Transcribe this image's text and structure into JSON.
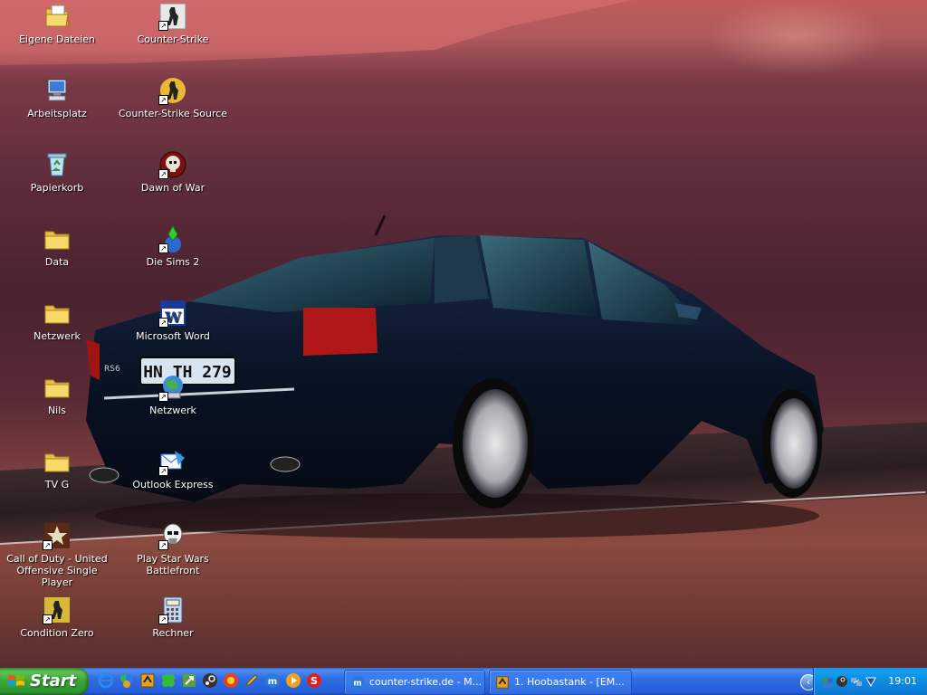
{
  "desktop": {
    "icons": [
      {
        "label": "Eigene Dateien",
        "icon": "my-documents-icon",
        "shortcut": false
      },
      {
        "label": "Arbeitsplatz",
        "icon": "my-computer-icon",
        "shortcut": false
      },
      {
        "label": "Papierkorb",
        "icon": "recycle-bin-icon",
        "shortcut": false
      },
      {
        "label": "Data",
        "icon": "folder-icon",
        "shortcut": false
      },
      {
        "label": "Netzwerk",
        "icon": "folder-icon",
        "shortcut": false
      },
      {
        "label": "Nils",
        "icon": "folder-icon",
        "shortcut": false
      },
      {
        "label": "TV G",
        "icon": "folder-icon",
        "shortcut": false
      },
      {
        "label": "Call of Duty - United Offensive Single Player",
        "icon": "call-of-duty-icon",
        "shortcut": true
      },
      {
        "label": "Condition Zero",
        "icon": "condition-zero-icon",
        "shortcut": true
      },
      {
        "label": "Counter-Strike",
        "icon": "counter-strike-icon",
        "shortcut": true
      },
      {
        "label": "Counter-Strike Source",
        "icon": "counter-strike-source-icon",
        "shortcut": true
      },
      {
        "label": "Dawn of War",
        "icon": "dawn-of-war-icon",
        "shortcut": true
      },
      {
        "label": "Die Sims 2",
        "icon": "sims-2-icon",
        "shortcut": true
      },
      {
        "label": "Microsoft Word",
        "icon": "word-icon",
        "shortcut": true
      },
      {
        "label": "Netzwerk",
        "icon": "network-icon",
        "shortcut": true
      },
      {
        "label": "Outlook Express",
        "icon": "outlook-express-icon",
        "shortcut": true
      },
      {
        "label": "Play Star Wars Battlefront",
        "icon": "star-wars-battlefront-icon",
        "shortcut": true
      },
      {
        "label": "Rechner",
        "icon": "calculator-icon",
        "shortcut": true
      }
    ]
  },
  "wallpaper": {
    "plate": "HN TH 279",
    "badge": "RS6"
  },
  "taskbar": {
    "start_label": "Start",
    "quick_launch": [
      "internet-explorer-icon",
      "messenger-icon",
      "winamp-icon",
      "clover-icon",
      "arrow-tool-icon",
      "steam-icon",
      "media-icon",
      "pencil-icon",
      "maxthon-icon",
      "media-player-icon",
      "skype-icon"
    ],
    "tasks": [
      {
        "label": "counter-strike.de - M...",
        "icon": "maxthon-icon"
      },
      {
        "label": "1. Hoobastank - [EM...",
        "icon": "winamp-icon"
      }
    ],
    "tray_icons": [
      "show-hidden-icons-icon",
      "users-icon",
      "steam-tray-icon",
      "network-tray-icon",
      "winamp-tray-icon"
    ],
    "clock": "19:01"
  },
  "colors": {
    "taskbar_blue": "#245edb",
    "start_green": "#3aa636",
    "tray_blue": "#0f8ae0"
  }
}
